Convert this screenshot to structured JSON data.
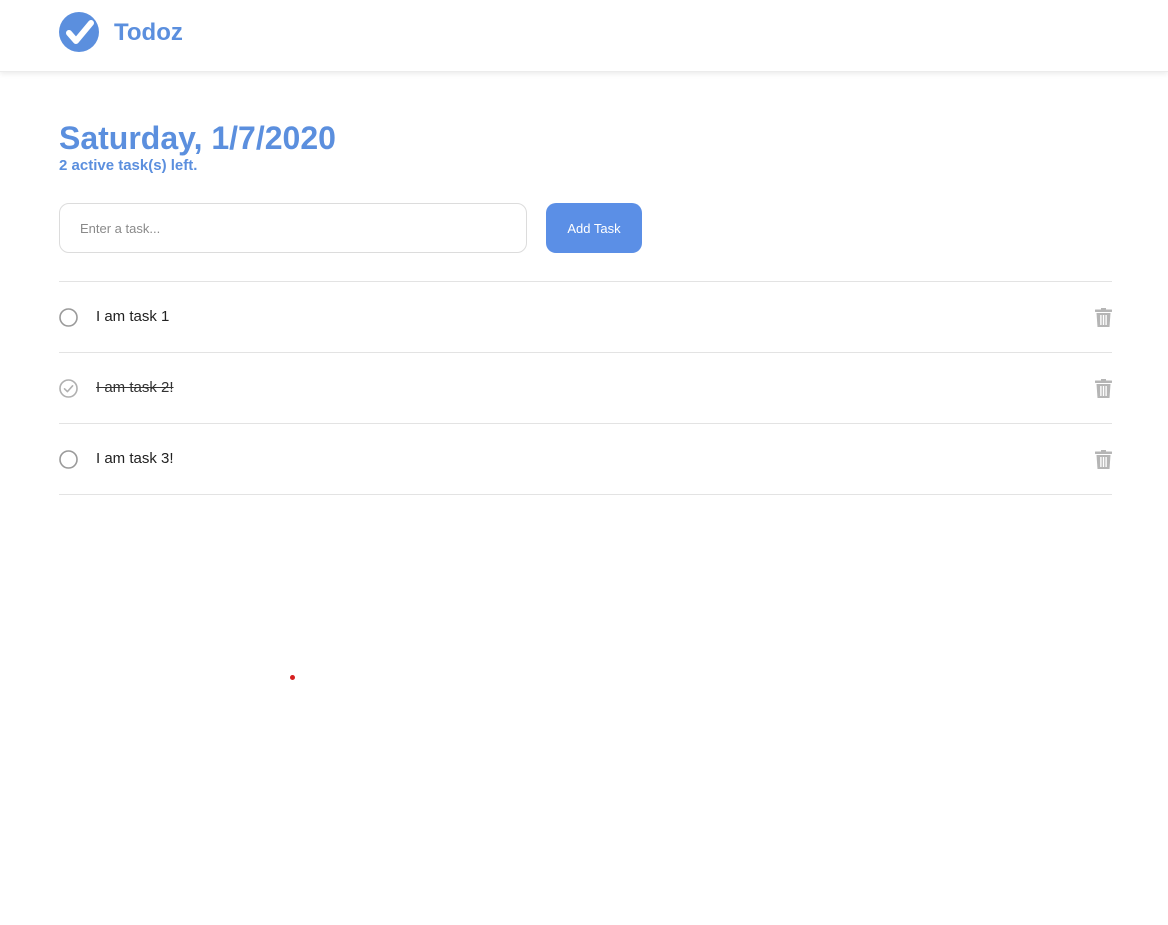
{
  "header": {
    "brand": "Todoz",
    "logo_icon": "check-circle-icon",
    "accent_color": "#5b8fde"
  },
  "main": {
    "date_title": "Saturday, 1/7/2020",
    "active_count_text": "2 active task(s) left."
  },
  "new_task": {
    "placeholder": "Enter a task...",
    "value": "",
    "add_label": "Add Task"
  },
  "tasks": [
    {
      "text": "I am task 1",
      "completed": false,
      "delete_icon": "trash-icon"
    },
    {
      "text": "I am task 2!",
      "completed": true,
      "delete_icon": "trash-icon"
    },
    {
      "text": "I am task 3!",
      "completed": false,
      "delete_icon": "trash-icon"
    }
  ]
}
